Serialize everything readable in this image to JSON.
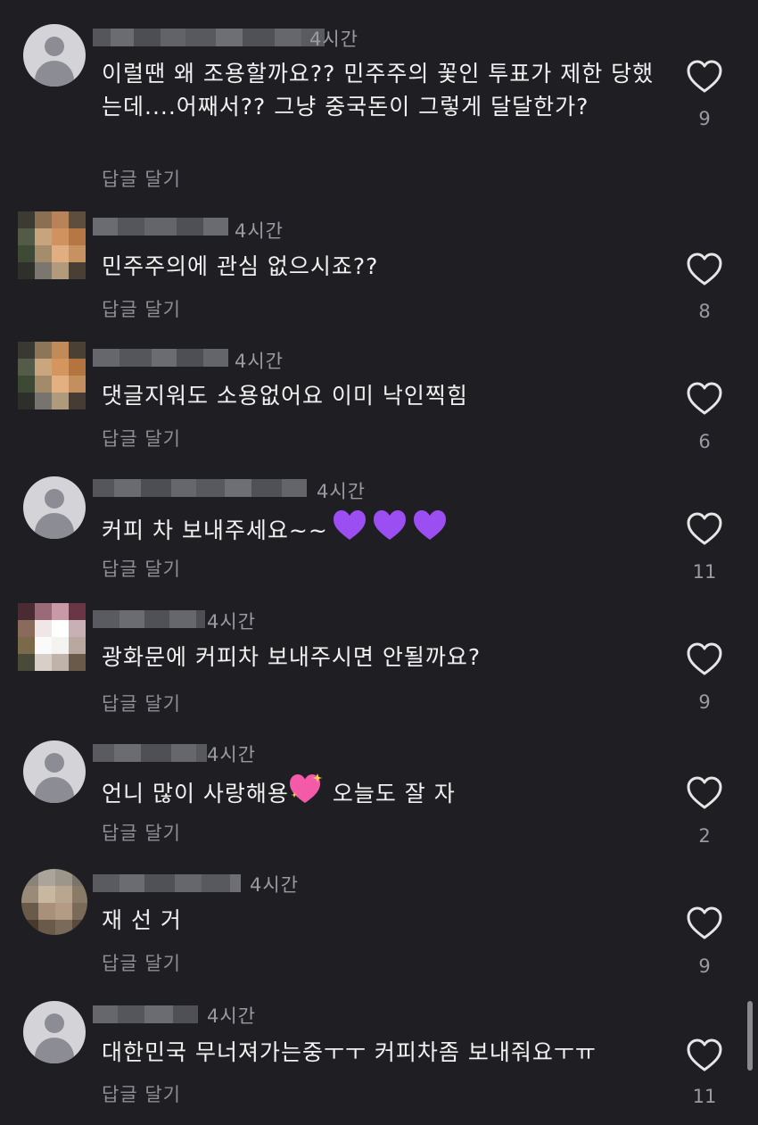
{
  "reply_label": "답글 달기",
  "colors": {
    "background": "#1f1f23",
    "text": "#f1f1f1",
    "muted": "#9a9aa2",
    "heart_outline": "#e6e6e6"
  },
  "comments": [
    {
      "time": "4시간",
      "text": "이럴땐 왜 조용할까요?? 민주주의 꽃인 투표가 제한 당했는데....어째서?? 그냥 중국돈이 그렇게 달달한가?",
      "likes": "9",
      "avatar": "default"
    },
    {
      "time": "4시간",
      "text": "민주주의에 관심 없으시죠??",
      "likes": "8",
      "avatar": "photo"
    },
    {
      "time": "4시간",
      "text": "댓글지워도 소용없어요 이미 낙인찍힘",
      "likes": "6",
      "avatar": "photo"
    },
    {
      "time": "4시간",
      "text": "커피 차 보내주세요~~",
      "emoji": "purple-heart x3",
      "likes": "11",
      "avatar": "default"
    },
    {
      "time": "4시간",
      "text": "광화문에 커피차 보내주시면 안될까요?",
      "likes": "9",
      "avatar": "photo"
    },
    {
      "time": "4시간",
      "text_before": "언니 많이 사랑해용",
      "text_after": " 오늘도 잘 자",
      "emoji": "sparkling-heart",
      "likes": "2",
      "avatar": "default"
    },
    {
      "time": "4시간",
      "text": "재 선 거",
      "likes": "9",
      "avatar": "photo"
    },
    {
      "time": "4시간",
      "text": "대한민국 무너져가는중ㅜㅜ 커피차좀 보내줘요ㅜㅠ",
      "likes": "11",
      "avatar": "default"
    }
  ]
}
